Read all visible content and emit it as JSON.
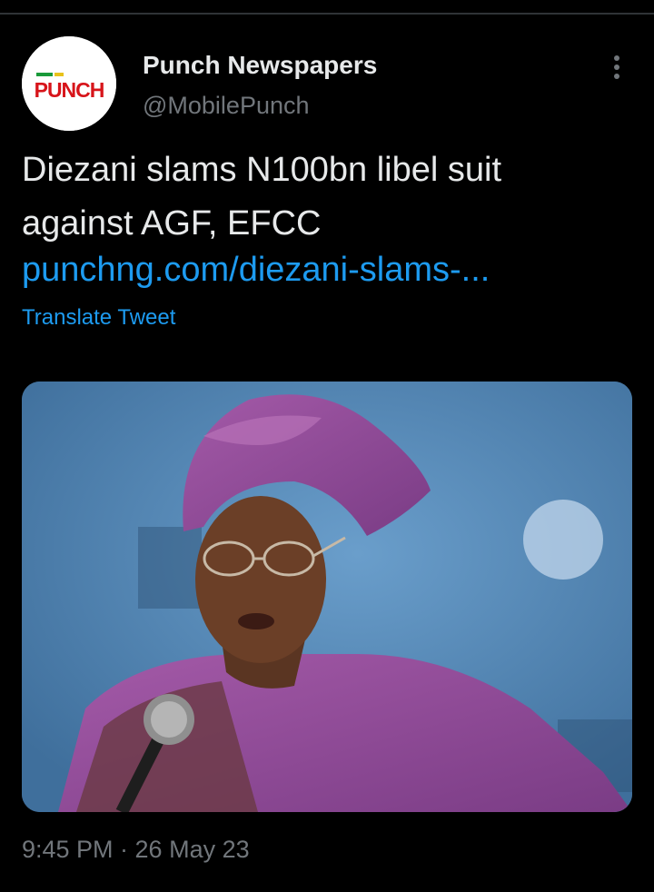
{
  "tweet": {
    "author_name": "Punch Newspapers",
    "author_handle": "@MobilePunch",
    "avatar_logo_text": "PUNCH",
    "text": "Diezani slams N100bn libel suit against AGF, EFCC",
    "link_text": "punchng.com/diezani-slams-...",
    "translate_label": "Translate Tweet",
    "timestamp": "9:45 PM · 26 May 23",
    "more_icon": "more-dots-icon",
    "media_description_icon": "photo"
  },
  "colors": {
    "background": "#000000",
    "primary_text": "#e7e9ea",
    "secondary_text": "#71767b",
    "link": "#1d9bf0",
    "punch_red": "#d7141a",
    "punch_green": "#1a9a3a"
  }
}
